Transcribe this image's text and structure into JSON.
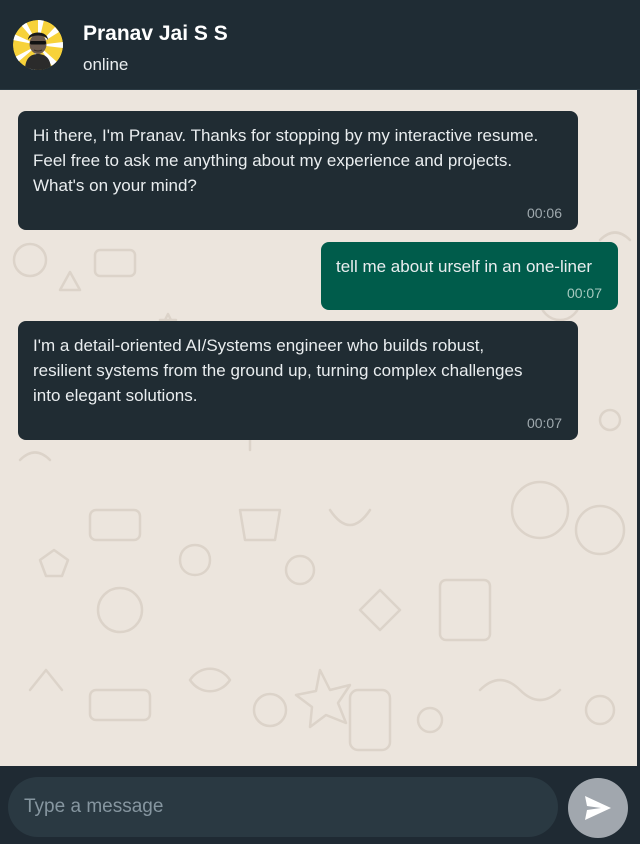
{
  "header": {
    "name": "Pranav Jai S S",
    "status": "online"
  },
  "messages": [
    {
      "direction": "in",
      "text": "Hi there, I'm Pranav. Thanks for stopping by my interactive resume.\nFeel free to ask me anything about my experience and projects.\nWhat's on your mind?",
      "time": "00:06"
    },
    {
      "direction": "out",
      "text": "tell me about urself in an one-liner",
      "time": "00:07"
    },
    {
      "direction": "in",
      "text": "I'm a detail-oriented AI/Systems engineer who builds robust,\nresilient systems from the ground up, turning complex challenges\ninto elegant solutions.",
      "time": "00:07"
    }
  ],
  "composer": {
    "placeholder": "Type a message",
    "value": "",
    "send_icon": "send-icon"
  },
  "colors": {
    "header_bg": "#1f2c34",
    "chat_bg": "#ece5dd",
    "incoming_bubble": "#202c33",
    "outgoing_bubble": "#005c4b",
    "input_bg": "#2a3942",
    "send_button": "#a1a7ae"
  }
}
